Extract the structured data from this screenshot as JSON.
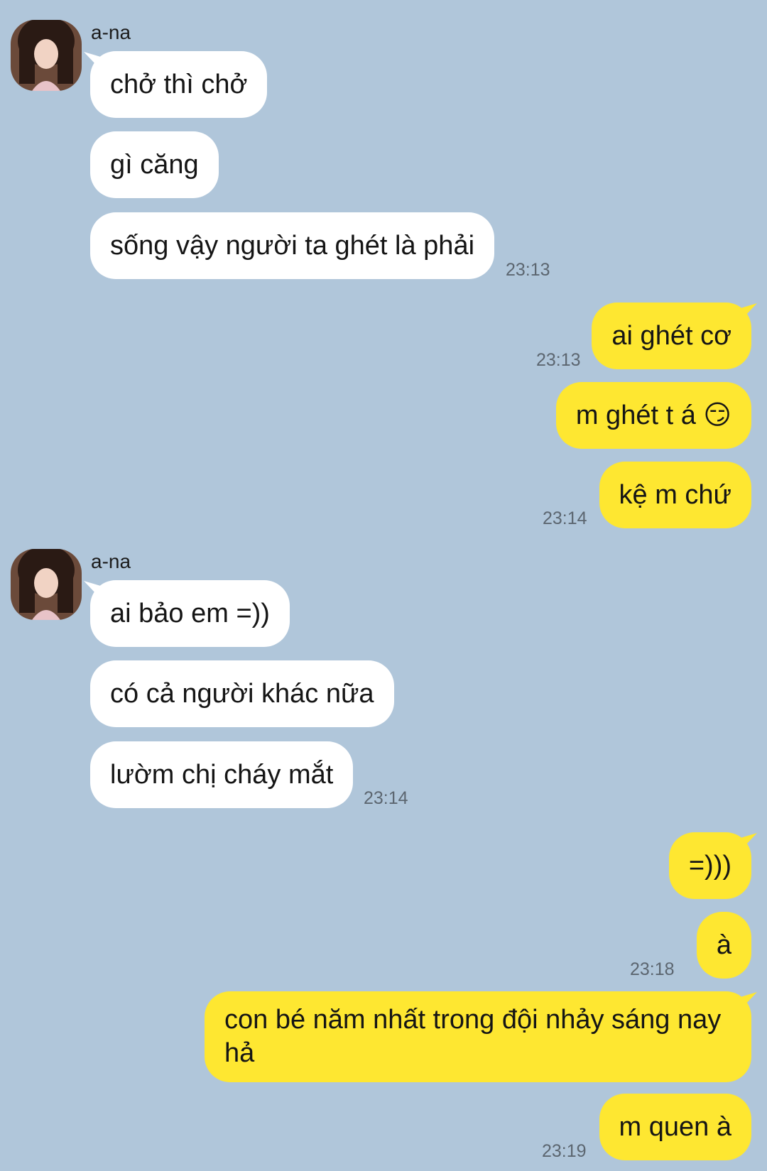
{
  "contact": {
    "name": "a-na",
    "avatar_icon": "contact-avatar-photo"
  },
  "messages": [
    {
      "text": "chở thì chở"
    },
    {
      "text": "gì căng"
    },
    {
      "text": "sống vậy người ta ghét là phải",
      "time": "23:13"
    },
    {
      "text": "ai ghét cơ",
      "time": "23:13"
    },
    {
      "text": "m ghét t á 😏"
    },
    {
      "text": "kệ m chứ",
      "time": "23:14"
    },
    {
      "text": "ai bảo em =))"
    },
    {
      "text": "có cả người khác nữa"
    },
    {
      "text": "lườm chị cháy mắt",
      "time": "23:14"
    },
    {
      "text": "=)))"
    },
    {
      "text": "à",
      "time": "23:18"
    },
    {
      "text": "con bé năm nhất trong đội nhảy sáng nay hả"
    },
    {
      "text": "m quen à",
      "time": "23:19"
    }
  ],
  "colors": {
    "background": "#b0c6da",
    "incoming_bubble": "#ffffff",
    "outgoing_bubble": "#fee731",
    "timestamp": "#5c6670"
  }
}
